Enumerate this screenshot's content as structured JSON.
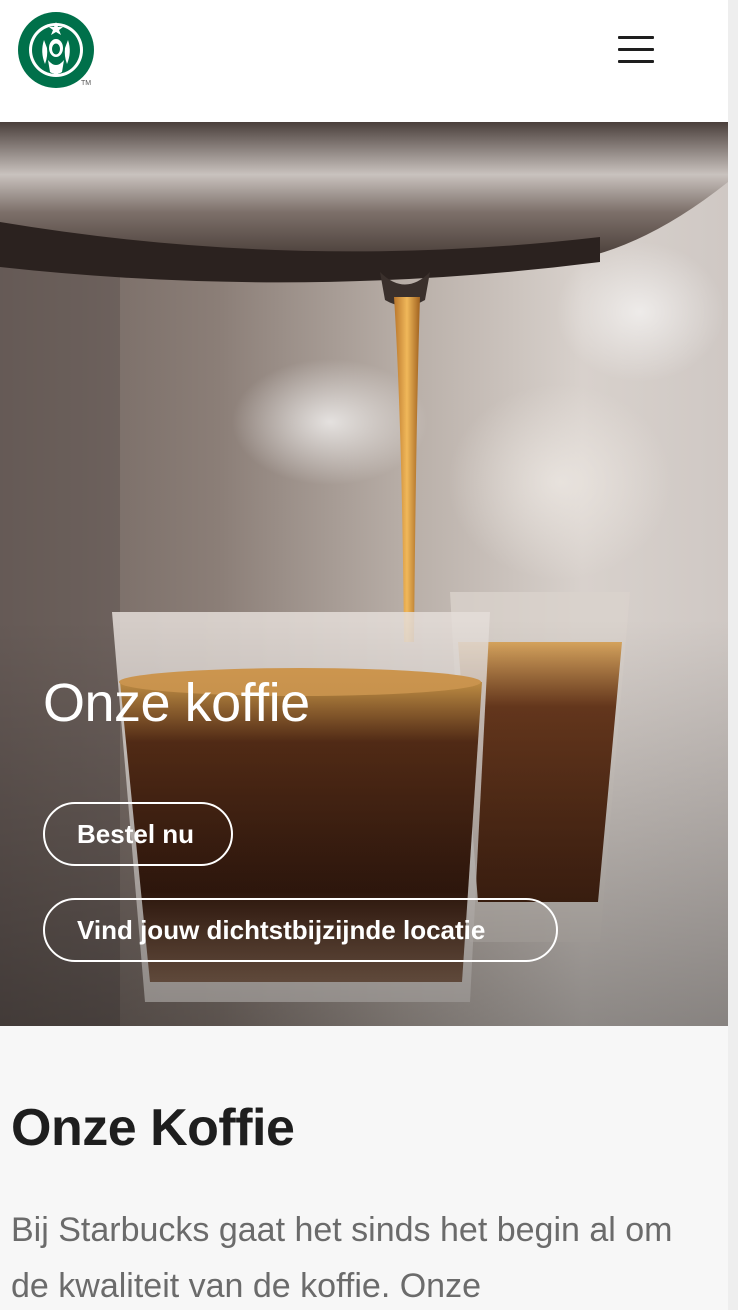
{
  "header": {
    "logo_trademark": "TM",
    "menu_icon": "hamburger-menu-icon"
  },
  "hero": {
    "title": "Onze koffie",
    "order_button": "Bestel nu",
    "locate_button": "Vind jouw dichtstbijzijnde locatie"
  },
  "section": {
    "title": "Onze Koffie",
    "text": "Bij Starbucks gaat het sinds het begin al om de kwaliteit van de koffie. Onze"
  },
  "colors": {
    "brand_green": "#00704a",
    "text_dark": "#1e1e1e",
    "text_muted": "#6b6b6b"
  }
}
